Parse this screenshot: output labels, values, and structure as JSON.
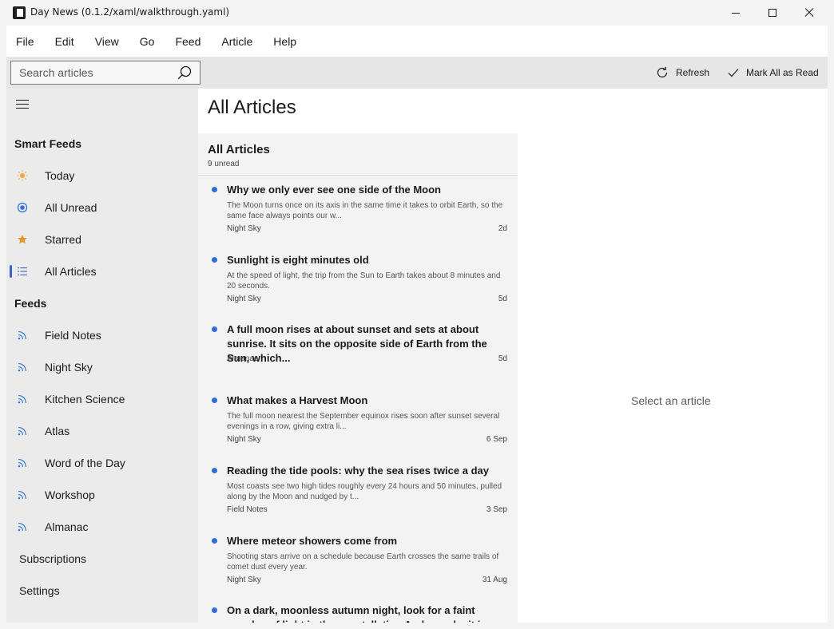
{
  "window": {
    "title": "Day News (0.1.2/xaml/walkthrough.yaml)",
    "minimize_icon": "minimize-icon",
    "maximize_icon": "maximize-icon",
    "close_icon": "close-icon"
  },
  "menu": [
    "File",
    "Edit",
    "View",
    "Go",
    "Feed",
    "Article",
    "Help"
  ],
  "toolbar": {
    "search_placeholder": "Search articles",
    "refresh_label": "Refresh",
    "mark_all_read_label": "Mark All as Read"
  },
  "sidebar": {
    "smart_feeds_title": "Smart Feeds",
    "smart_feeds": [
      {
        "label": "Today",
        "icon": "sun-icon"
      },
      {
        "label": "All Unread",
        "icon": "radio-icon"
      },
      {
        "label": "Starred",
        "icon": "star-icon"
      },
      {
        "label": "All Articles",
        "icon": "list-icon",
        "selected": true
      }
    ],
    "feeds_title": "Feeds",
    "feeds": [
      "Field Notes",
      "Night Sky",
      "Kitchen Science",
      "Atlas",
      "Word of the Day",
      "Workshop",
      "Almanac"
    ],
    "subscriptions_label": "Subscriptions",
    "settings_label": "Settings",
    "accent_color": "#3b64c8",
    "feed_icon_color": "#3b7fd8"
  },
  "main": {
    "page_title": "All Articles",
    "list_title": "All Articles",
    "unread_count": "9 unread",
    "empty_detail": "Select an article",
    "unread_dot_color": "#2f6cd3"
  },
  "articles": [
    {
      "title": "Why we only ever see one side of the Moon",
      "snippet": "The Moon turns once on its axis in the same time it takes to orbit Earth, so the same face always points our w...",
      "feed": "Night Sky",
      "time": "2d"
    },
    {
      "title": "Sunlight is eight minutes old",
      "snippet": "At the speed of light, the trip from the Sun to Earth takes about 8 minutes and 20 seconds.",
      "feed": "Night Sky",
      "time": "5d"
    },
    {
      "title": "A full moon rises at about sunset and sets at about sunrise. It sits on the opposite side of Earth from the Sun, which...",
      "snippet": "",
      "feed": "Almanac",
      "time": "5d"
    },
    {
      "title": "What makes a Harvest Moon",
      "snippet": "The full moon nearest the September equinox rises soon after sunset several evenings in a row, giving extra li...",
      "feed": "Night Sky",
      "time": "6 Sep"
    },
    {
      "title": "Reading the tide pools: why the sea rises twice a day",
      "snippet": "Most coasts see two high tides roughly every 24 hours and 50 minutes, pulled along by the Moon and nudged by t...",
      "feed": "Field Notes",
      "time": "3 Sep"
    },
    {
      "title": "Where meteor showers come from",
      "snippet": "Shooting stars arrive on a schedule because Earth crosses the same trails of comet dust every year.",
      "feed": "Night Sky",
      "time": "31 Aug"
    },
    {
      "title": "On a dark, moonless autumn night, look for a faint smudge of light in the constellation Andromeda: it is the...",
      "snippet": "",
      "feed": "",
      "time": ""
    }
  ]
}
